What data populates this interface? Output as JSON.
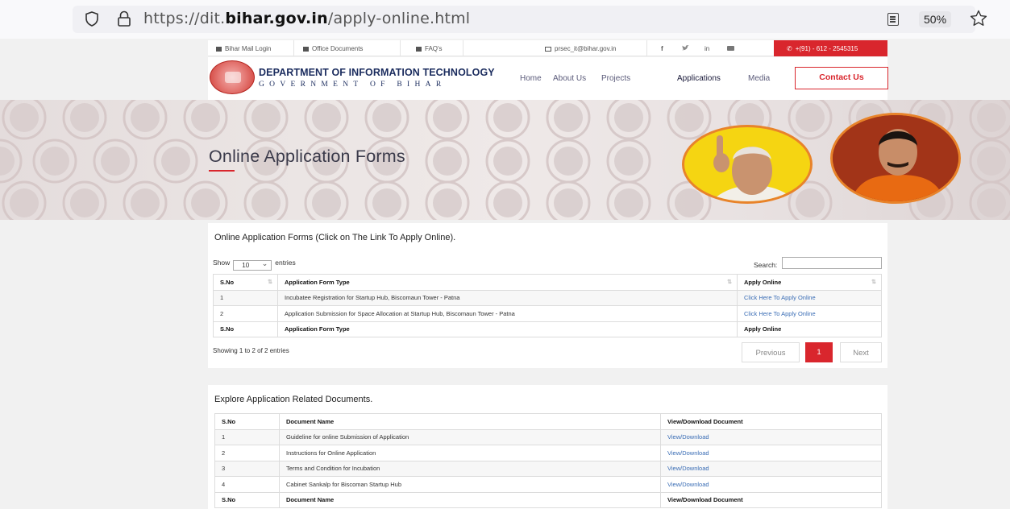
{
  "browser": {
    "url_prefix": "https://dit.",
    "url_domain": "bihar.gov.in",
    "url_path": "/apply-online.html",
    "zoom": "50%"
  },
  "topbar": {
    "mail_login": "Bihar Mail Login",
    "office_docs": "Office Documents",
    "faqs": "FAQ's",
    "email": "prsec_it@bihar.gov.in",
    "social": [
      "f",
      "in"
    ],
    "phone": "+(91) - 612 - 2545315"
  },
  "header": {
    "title": "DEPARTMENT OF INFORMATION TECHNOLOGY",
    "subtitle": "GOVERNMENT OF BIHAR",
    "nav": [
      "Home",
      "About Us",
      "Projects",
      "Applications",
      "Media"
    ],
    "contact": "Contact Us"
  },
  "banner": {
    "title": "Online Application Forms"
  },
  "forms": {
    "heading": "Online Application Forms (Click on The Link To Apply Online).",
    "show": "Show",
    "entries_value": "10",
    "entries": "entries",
    "search_label": "Search:",
    "columns": [
      "S.No",
      "Application Form Type",
      "Apply Online"
    ],
    "rows": [
      [
        "1",
        "Incubatee Registration for Startup Hub, Biscomaun Tower - Patna",
        "Click Here To Apply Online"
      ],
      [
        "2",
        "Application Submission for Space Allocation at Startup Hub, Biscomaun Tower - Patna",
        "Click Here To Apply Online"
      ]
    ],
    "showing": "Showing 1 to 2 of 2 entries",
    "prev": "Previous",
    "page": "1",
    "next": "Next"
  },
  "docs": {
    "heading": "Explore Application Related Documents.",
    "columns": [
      "S.No",
      "Document Name",
      "View/Download Document"
    ],
    "rows": [
      [
        "1",
        "Guideline for online Submission of Application",
        "View/Download"
      ],
      [
        "2",
        "Instructions for Online Application",
        "View/Download"
      ],
      [
        "3",
        "Terms and Condition for Incubation",
        "View/Download"
      ],
      [
        "4",
        "Cabinet Sankalp for Biscoman Startup Hub",
        "View/Download"
      ]
    ]
  },
  "colors": {
    "accent": "#d9262d",
    "link": "#3a6db5",
    "navy": "#1b2c5e"
  }
}
